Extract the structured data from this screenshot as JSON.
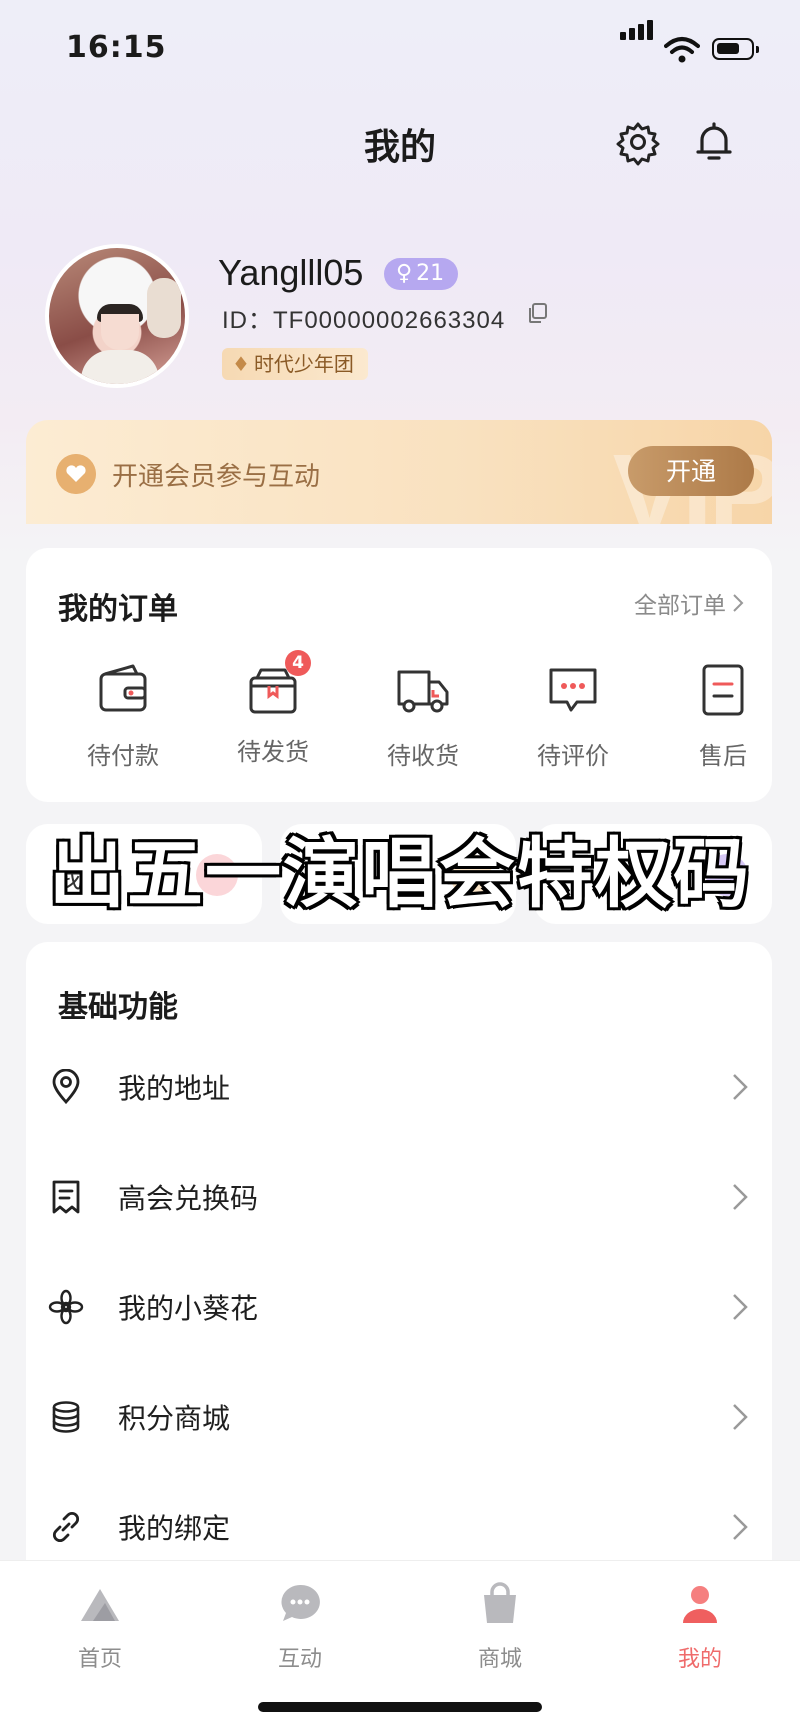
{
  "status_bar": {
    "time": "16:15"
  },
  "header": {
    "title": "我的",
    "settings_icon": "gear-icon",
    "notification_icon": "bell-icon"
  },
  "profile": {
    "username": "Yanglll05",
    "level": "21",
    "id_text": "ID：TF00000002663304",
    "tag": "时代少年团"
  },
  "vip": {
    "text": "开通会员参与互动",
    "button": "开通",
    "watermark": "VIP",
    "accent": "#ad7a48"
  },
  "orders": {
    "title": "我的订单",
    "all_label": "全部订单",
    "items": [
      {
        "label": "待付款",
        "icon": "wallet-icon"
      },
      {
        "label": "待发货",
        "icon": "package-icon",
        "badge": "4"
      },
      {
        "label": "待收货",
        "icon": "truck-icon"
      },
      {
        "label": "待评价",
        "icon": "comment-icon"
      },
      {
        "label": "售后",
        "icon": "aftersale-icon"
      }
    ]
  },
  "quick_cards": [
    {
      "label": "我"
    }
  ],
  "overlay_caption": "出五一演唱会特权码",
  "basic": {
    "title": "基础功能",
    "items": [
      {
        "label": "我的地址",
        "icon": "location-pin-icon"
      },
      {
        "label": "高会兑换码",
        "icon": "receipt-icon"
      },
      {
        "label": "我的小葵花",
        "icon": "flower-icon"
      },
      {
        "label": "积分商城",
        "icon": "coins-icon"
      },
      {
        "label": "我的绑定",
        "icon": "link-icon"
      }
    ]
  },
  "tabbar": {
    "items": [
      {
        "label": "首页",
        "icon": "home-mountain-icon"
      },
      {
        "label": "互动",
        "icon": "chat-icon"
      },
      {
        "label": "商城",
        "icon": "shopping-bag-icon"
      },
      {
        "label": "我的",
        "icon": "person-icon",
        "active": true
      }
    ],
    "active_color": "#ef6b6b"
  }
}
